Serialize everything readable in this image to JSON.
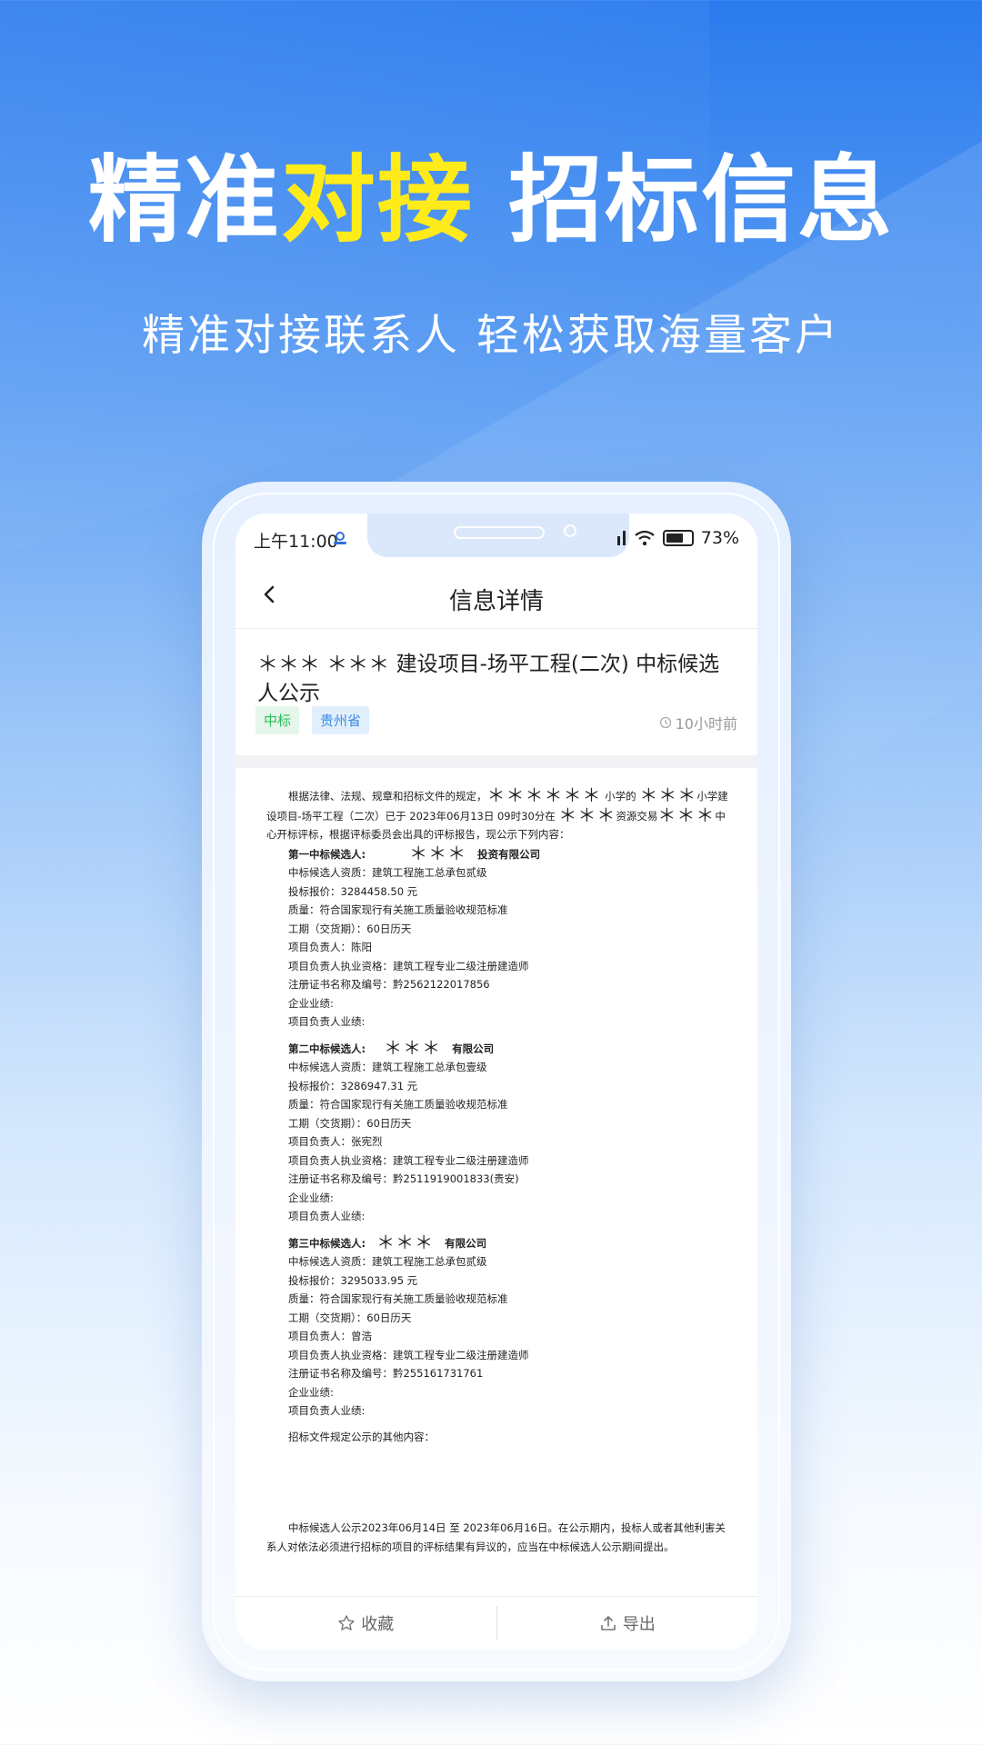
{
  "hero": {
    "title_part1": "精准",
    "title_highlight": "对接",
    "title_part2": " 招标信息",
    "subtitle": "精准对接联系人 轻松获取海量客户",
    "highlight_color": "#ffeb1a"
  },
  "status_bar": {
    "time": "上午11:00",
    "battery": "73"
  },
  "nav": {
    "title": "信息详情",
    "back_icon": "chevron-left-icon"
  },
  "article": {
    "title": "＊＊＊ ＊＊＊  建设项目-场平工程(二次) 中标候选人公示",
    "tags": [
      "中标",
      "贵州省"
    ],
    "time_ago": "10小时前"
  },
  "document": {
    "intro_1": "根据法律、法规、规章和招标文件的规定，",
    "intro_stars_1": "＊＊＊＊＊＊",
    "intro_2": " 小学的 ",
    "intro_stars_2": "＊＊＊",
    "intro_3": "小学建设项目-场平工程（二次）已于 2023年06月13日 09时30分在 ",
    "intro_stars_3": "＊＊＊",
    "intro_4": "资源交易",
    "intro_stars_4": "＊＊＊",
    "intro_5": "中心开标评标，根据评标委员会出具的评标报告，现公示下列内容：",
    "candidates": [
      {
        "head": "第一中标候选人:",
        "stars": "＊＊＊",
        "company": "投资有限公司",
        "lines": [
          "中标候选人资质：建筑工程施工总承包贰级",
          "投标报价：3284458.50 元",
          "质量：符合国家现行有关施工质量验收规范标准",
          "工期（交货期）：60日历天",
          "项目负责人：陈阳",
          "项目负责人执业资格：建筑工程专业二级注册建造师",
          "注册证书名称及编号：黔2562122017856",
          "企业业绩:",
          "项目负责人业绩:"
        ]
      },
      {
        "head": "第二中标候选人:",
        "stars": "＊＊＊",
        "company": "有限公司",
        "lines": [
          "中标候选人资质：建筑工程施工总承包壹级",
          "投标报价：3286947.31 元",
          "质量：符合国家现行有关施工质量验收规范标准",
          "工期（交货期）：60日历天",
          "项目负责人：张宪烈",
          "项目负责人执业资格：建筑工程专业二级注册建造师",
          "注册证书名称及编号：黔2511919001833(贵安)",
          "企业业绩:",
          "项目负责人业绩:"
        ]
      },
      {
        "head": "第三中标候选人:",
        "stars": "＊＊＊",
        "company": "有限公司",
        "lines": [
          "中标候选人资质：建筑工程施工总承包贰级",
          "投标报价：3295033.95 元",
          "质量：符合国家现行有关施工质量验收规范标准",
          "工期（交货期）：60日历天",
          "项目负责人：曾浩",
          "项目负责人执业资格：建筑工程专业二级注册建造师",
          "注册证书名称及编号：黔255161731761",
          "企业业绩:",
          "项目负责人业绩:"
        ]
      }
    ],
    "other_content": "招标文件规定公示的其他内容：",
    "notice": "中标候选人公示2023年06月14日 至 2023年06月16日。在公示期内，投标人或者其他利害关系人对依法必须进行招标的项目的评标结果有异议的，应当在中标候选人公示期间提出。"
  },
  "bottom_bar": {
    "favorite_label": "收藏",
    "export_label": "导出"
  }
}
